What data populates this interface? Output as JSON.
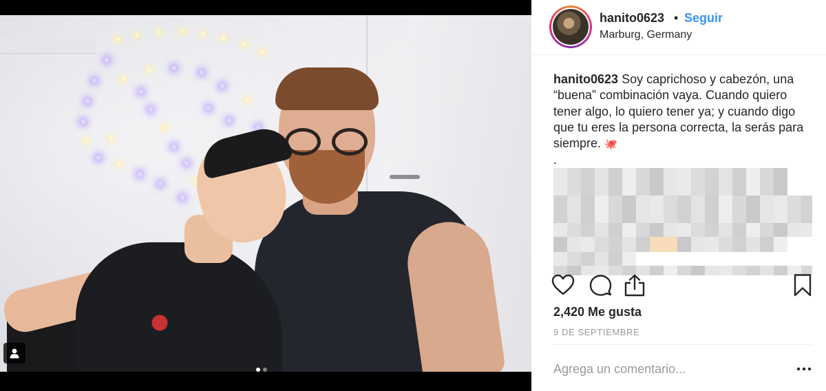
{
  "post": {
    "photo_count": 2,
    "active_photo": 1
  },
  "header": {
    "username": "hanito0623",
    "separator": "•",
    "follow_label": "Seguir",
    "location": "Marburg, Germany"
  },
  "caption": {
    "username": "hanito0623",
    "text": "Soy caprichoso y cabezón, una “buena” combinación vaya. Cuando quiero tener algo, lo quiero tener ya; y cuando digo que tu eres la persona correcta, la serás para siempre.",
    "emoji": "🐙",
    "trailing": "."
  },
  "actions": {
    "like_icon": "heart-icon",
    "comment_icon": "comment-icon",
    "share_icon": "share-icon",
    "save_icon": "bookmark-icon"
  },
  "likes": "2,420 Me gusta",
  "date": "9 DE SEPTIEMBRE",
  "comment": {
    "placeholder": "Agrega un comentario...",
    "more_label": "•••"
  },
  "colors": {
    "accent": "#3897f0",
    "text": "#262626",
    "muted": "#999999"
  }
}
